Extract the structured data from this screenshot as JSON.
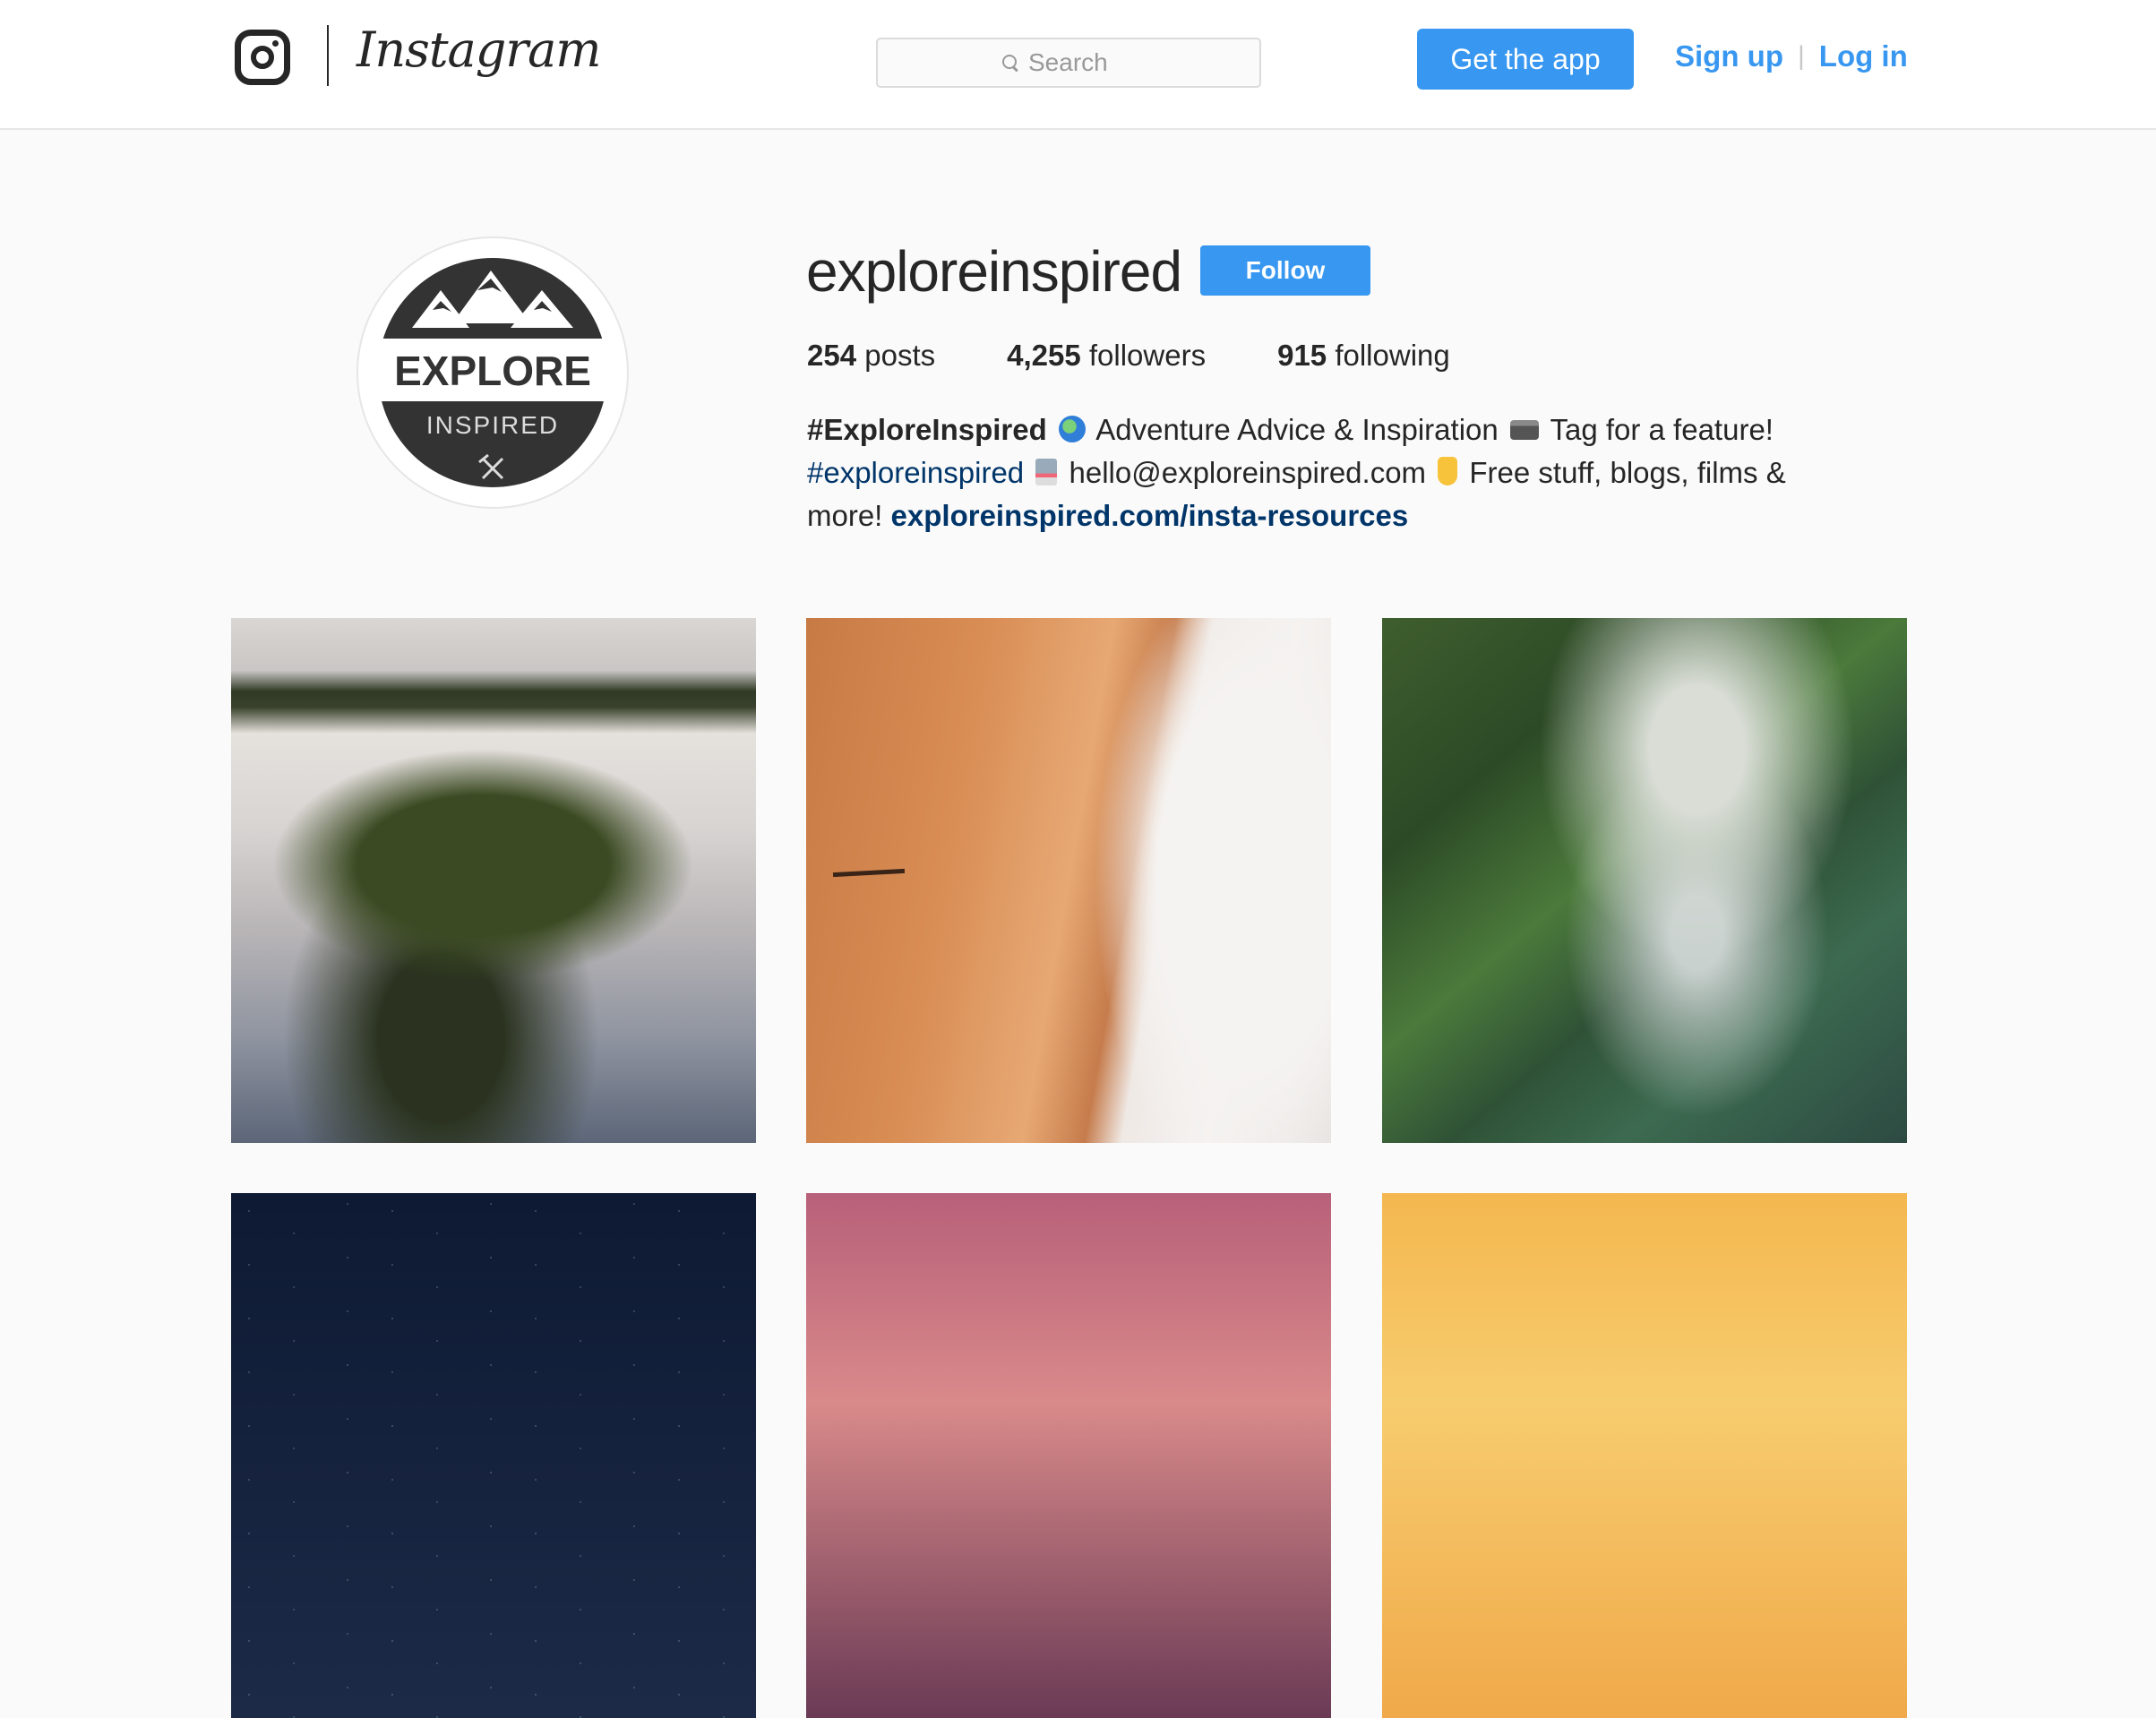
{
  "header": {
    "wordmark": "Instagram",
    "search_placeholder": "Search",
    "get_app_label": "Get the app",
    "sign_up_label": "Sign up",
    "separator": "|",
    "log_in_label": "Log in",
    "colors": {
      "accent": "#3897f0",
      "text": "#262626",
      "link_dark": "#003569"
    }
  },
  "profile": {
    "username": "exploreinspired",
    "follow_label": "Follow",
    "avatar_text": {
      "line1": "EXPLORE",
      "line2": "INSPIRED"
    },
    "stats": {
      "posts_count": "254",
      "posts_label": "posts",
      "followers_count": "4,255",
      "followers_label": "followers",
      "following_count": "915",
      "following_label": "following"
    },
    "bio": {
      "name": "#ExploreInspired",
      "text1": "Adventure Advice & Inspiration",
      "text2": "Tag for a feature!",
      "hashtag": "#exploreinspired",
      "email": "hello@exploreinspired.com",
      "text3": "Free stuff, blogs, films &",
      "text4": "more!",
      "url": "exploreinspired.com/insta-resources",
      "emoji_icons": [
        "globe-icon",
        "camera-icon",
        "laptop-icon",
        "pointing-down-icon"
      ]
    }
  },
  "grid": {
    "photos": [
      {
        "subject": "misty forested hill aerial"
      },
      {
        "subject": "aerial beach with waves"
      },
      {
        "subject": "rice terraces in misty jungle"
      },
      {
        "subject": "starry night sky"
      },
      {
        "subject": "pink sunset sky"
      },
      {
        "subject": "golden sunset sky"
      }
    ]
  }
}
